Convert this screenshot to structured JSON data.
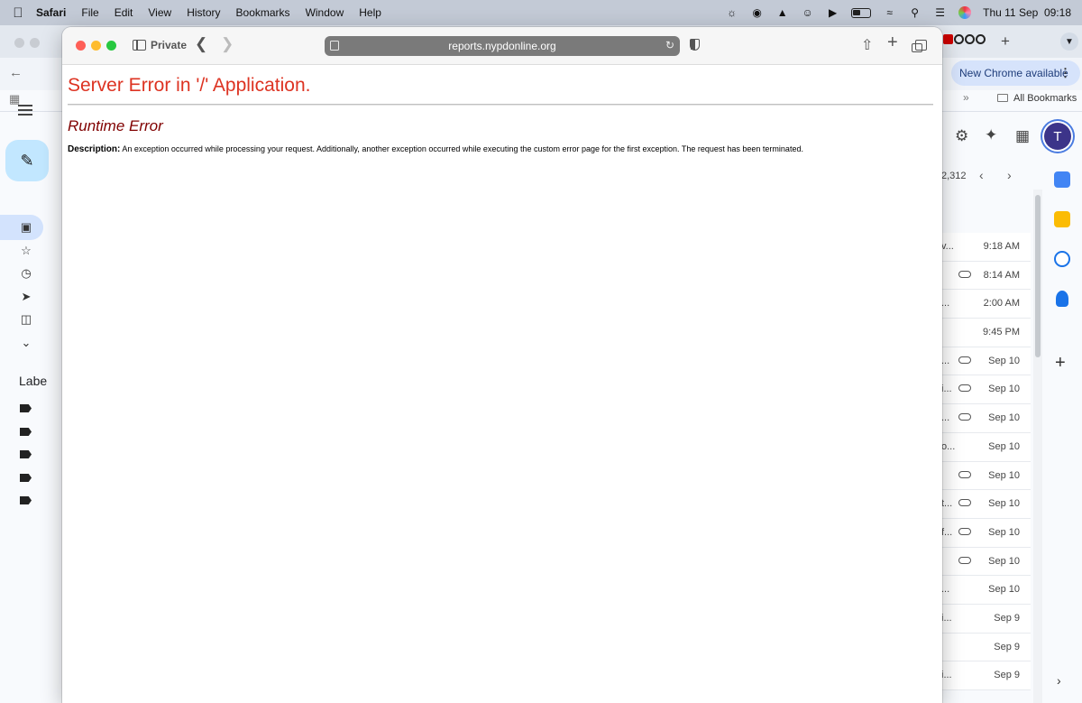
{
  "menubar": {
    "app_name": "Safari",
    "items": [
      "File",
      "Edit",
      "View",
      "History",
      "Bookmarks",
      "Window",
      "Help"
    ],
    "datetime": "Thu 11 Sep  09:18"
  },
  "chrome": {
    "banner": "New Chrome available",
    "bookmarks_label": "All Bookmarks",
    "avatar_letter": "T",
    "message_count": "2,312",
    "mail_rows": [
      {
        "snippet": "v...",
        "attachment": false,
        "time": "9:18 AM"
      },
      {
        "snippet": "",
        "attachment": true,
        "time": "8:14 AM"
      },
      {
        "snippet": "...",
        "attachment": false,
        "time": "2:00 AM"
      },
      {
        "snippet": "",
        "attachment": false,
        "time": "9:45 PM"
      },
      {
        "snippet": "...",
        "attachment": true,
        "time": "Sep 10"
      },
      {
        "snippet": "i...",
        "attachment": true,
        "time": "Sep 10"
      },
      {
        "snippet": "...",
        "attachment": true,
        "time": "Sep 10"
      },
      {
        "snippet": "o...",
        "attachment": false,
        "time": "Sep 10"
      },
      {
        "snippet": "",
        "attachment": true,
        "time": "Sep 10"
      },
      {
        "snippet": "t...",
        "attachment": true,
        "time": "Sep 10"
      },
      {
        "snippet": "f...",
        "attachment": true,
        "time": "Sep 10"
      },
      {
        "snippet": "",
        "attachment": true,
        "time": "Sep 10"
      },
      {
        "snippet": "...",
        "attachment": false,
        "time": "Sep 10"
      },
      {
        "snippet": "i...",
        "attachment": false,
        "time": "Sep 9"
      },
      {
        "snippet": "",
        "attachment": false,
        "time": "Sep 9"
      },
      {
        "snippet": "i...",
        "attachment": false,
        "time": "Sep 9"
      }
    ],
    "labels_heading": "Labe"
  },
  "safari": {
    "private_label": "Private",
    "url": "reports.nypdonline.org"
  },
  "error_page": {
    "title": "Server Error in '/' Application.",
    "subtitle": "Runtime Error",
    "description_label": "Description:",
    "description_text": "An exception occurred while processing your request. Additionally, another exception occurred while executing the custom error page for the first exception. The request has been terminated."
  },
  "colors": {
    "error_title": "#dd3322",
    "error_subtitle": "#800000",
    "gmail_compose": "#c2e7ff",
    "avatar_bg": "#3c3489"
  }
}
